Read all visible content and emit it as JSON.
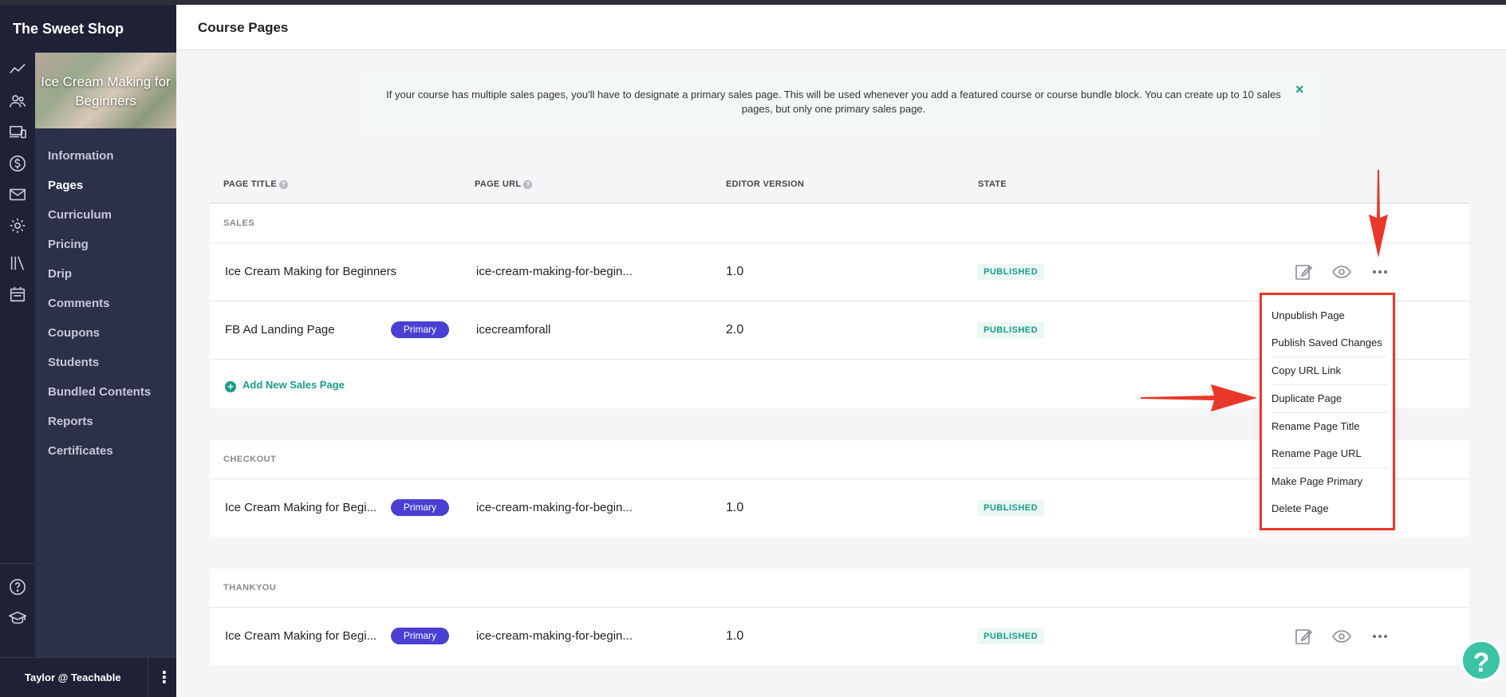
{
  "brand": {
    "name": "The Sweet Shop"
  },
  "course": {
    "title": "Ice Cream Making for Beginners"
  },
  "course_nav": [
    {
      "label": "Information",
      "active": false
    },
    {
      "label": "Pages",
      "active": true
    },
    {
      "label": "Curriculum",
      "active": false
    },
    {
      "label": "Pricing",
      "active": false
    },
    {
      "label": "Drip",
      "active": false
    },
    {
      "label": "Comments",
      "active": false
    },
    {
      "label": "Coupons",
      "active": false
    },
    {
      "label": "Students",
      "active": false
    },
    {
      "label": "Bundled Contents",
      "active": false
    },
    {
      "label": "Reports",
      "active": false
    },
    {
      "label": "Certificates",
      "active": false
    }
  ],
  "rail_icons": [
    "trend-icon",
    "users-icon",
    "devices-icon",
    "dollar-icon",
    "mail-icon",
    "gear-icon",
    "library-icon",
    "calendar-icon",
    "help-icon",
    "school-icon"
  ],
  "user": {
    "name": "Taylor @ Teachable"
  },
  "header": {
    "title": "Course Pages"
  },
  "notice": {
    "text": "If your course has multiple sales pages, you'll have to designate a primary sales page. This will be used whenever you add a featured course or course bundle block. You can create up to 10 sales pages, but only one primary sales page.",
    "close": "×"
  },
  "table": {
    "columns": {
      "title": "PAGE TITLE",
      "url": "PAGE URL",
      "editor": "EDITOR VERSION",
      "state": "STATE"
    },
    "groups": {
      "sales": {
        "label": "SALES",
        "rows": [
          {
            "title": "Ice Cream Making for Beginners",
            "primary": "",
            "url": "ice-cream-making-for-begin...",
            "version": "1.0",
            "state": "PUBLISHED"
          },
          {
            "title": "FB Ad Landing Page",
            "primary": "Primary",
            "url": "icecreamforall",
            "version": "2.0",
            "state": "PUBLISHED"
          }
        ],
        "add_label": "Add New Sales Page"
      },
      "checkout": {
        "label": "CHECKOUT",
        "rows": [
          {
            "title": "Ice Cream Making for Begi...",
            "primary": "Primary",
            "url": "ice-cream-making-for-begin...",
            "version": "1.0",
            "state": "PUBLISHED"
          }
        ]
      },
      "thankyou": {
        "label": "THANKYOU",
        "rows": [
          {
            "title": "Ice Cream Making for Begi...",
            "primary": "Primary",
            "url": "ice-cream-making-for-begin...",
            "version": "1.0",
            "state": "PUBLISHED"
          }
        ]
      }
    }
  },
  "dropdown": {
    "items": [
      "Unpublish Page",
      "Publish Saved Changes",
      "Copy URL Link",
      "Duplicate Page",
      "Rename Page Title",
      "Rename Page URL",
      "Make Page Primary",
      "Delete Page"
    ]
  },
  "help_bubble": "?",
  "colors": {
    "sidebar_dark": "#1f2236",
    "sidebar_nav": "#2c3048",
    "accent_teal": "#1a9c86",
    "primary_badge": "#4a3fd3",
    "annotation_red": "#e8382a"
  }
}
